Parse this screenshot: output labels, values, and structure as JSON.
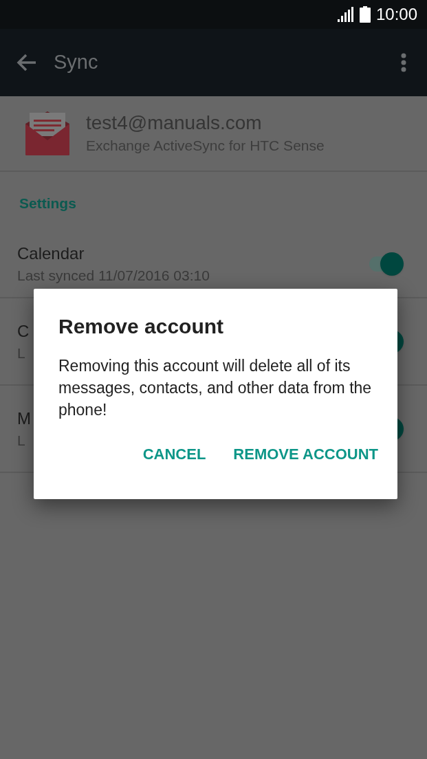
{
  "status_bar": {
    "time": "10:00"
  },
  "toolbar": {
    "title": "Sync"
  },
  "account": {
    "email": "test4@manuals.com",
    "type": "Exchange ActiveSync for HTC Sense"
  },
  "section_header": "Settings",
  "sync_items": [
    {
      "name": "Calendar",
      "status": "Last synced 11/07/2016 03:10",
      "on": true
    },
    {
      "name": "C",
      "status": "L",
      "on": true
    },
    {
      "name": "M",
      "status": "L",
      "on": true
    }
  ],
  "dialog": {
    "title": "Remove account",
    "message": "Removing this account will delete all of its messages, contacts, and other data from the phone!",
    "buttons": [
      "CANCEL",
      "REMOVE ACCOUNT"
    ]
  }
}
